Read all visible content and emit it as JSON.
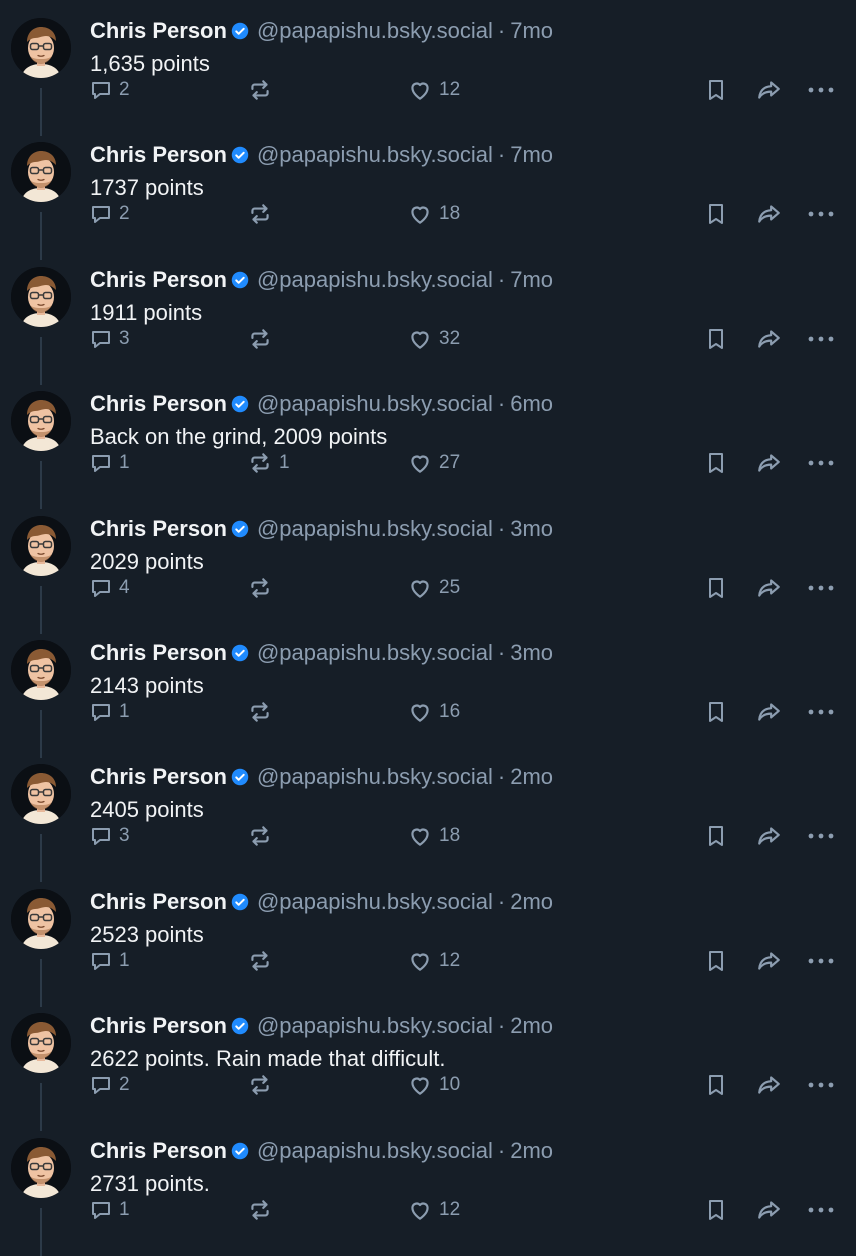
{
  "colors": {
    "background": "#161e27",
    "text": "#f1f3f5",
    "muted": "#8c9db0",
    "verified": "#208bfe",
    "thread_line": "#2c3a48"
  },
  "icons": {
    "reply": "speech-bubble-icon",
    "repost": "repost-arrows-icon",
    "like": "heart-icon",
    "bookmark": "bookmark-icon",
    "share": "share-arrow-icon",
    "more": "more-dots-icon",
    "verified": "verified-check-icon"
  },
  "posts": [
    {
      "author": "Chris Person",
      "handle": "@papapishu.bsky.social",
      "separator": "·",
      "time": "7mo",
      "text": "1,635 points",
      "replies": "2",
      "reposts": "",
      "likes": "12"
    },
    {
      "author": "Chris Person",
      "handle": "@papapishu.bsky.social",
      "separator": "·",
      "time": "7mo",
      "text": "1737 points",
      "replies": "2",
      "reposts": "",
      "likes": "18"
    },
    {
      "author": "Chris Person",
      "handle": "@papapishu.bsky.social",
      "separator": "·",
      "time": "7mo",
      "text": "1911 points",
      "replies": "3",
      "reposts": "",
      "likes": "32"
    },
    {
      "author": "Chris Person",
      "handle": "@papapishu.bsky.social",
      "separator": "·",
      "time": "6mo",
      "text": "Back on the grind, 2009 points",
      "replies": "1",
      "reposts": "1",
      "likes": "27"
    },
    {
      "author": "Chris Person",
      "handle": "@papapishu.bsky.social",
      "separator": "·",
      "time": "3mo",
      "text": "2029 points",
      "replies": "4",
      "reposts": "",
      "likes": "25"
    },
    {
      "author": "Chris Person",
      "handle": "@papapishu.bsky.social",
      "separator": "·",
      "time": "3mo",
      "text": "2143 points",
      "replies": "1",
      "reposts": "",
      "likes": "16"
    },
    {
      "author": "Chris Person",
      "handle": "@papapishu.bsky.social",
      "separator": "·",
      "time": "2mo",
      "text": "2405 points",
      "replies": "3",
      "reposts": "",
      "likes": "18"
    },
    {
      "author": "Chris Person",
      "handle": "@papapishu.bsky.social",
      "separator": "·",
      "time": "2mo",
      "text": "2523 points",
      "replies": "1",
      "reposts": "",
      "likes": "12"
    },
    {
      "author": "Chris Person",
      "handle": "@papapishu.bsky.social",
      "separator": "·",
      "time": "2mo",
      "text": "2622 points. Rain made that difficult.",
      "replies": "2",
      "reposts": "",
      "likes": "10"
    },
    {
      "author": "Chris Person",
      "handle": "@papapishu.bsky.social",
      "separator": "·",
      "time": "2mo",
      "text": "2731 points.",
      "replies": "1",
      "reposts": "",
      "likes": "12"
    }
  ]
}
